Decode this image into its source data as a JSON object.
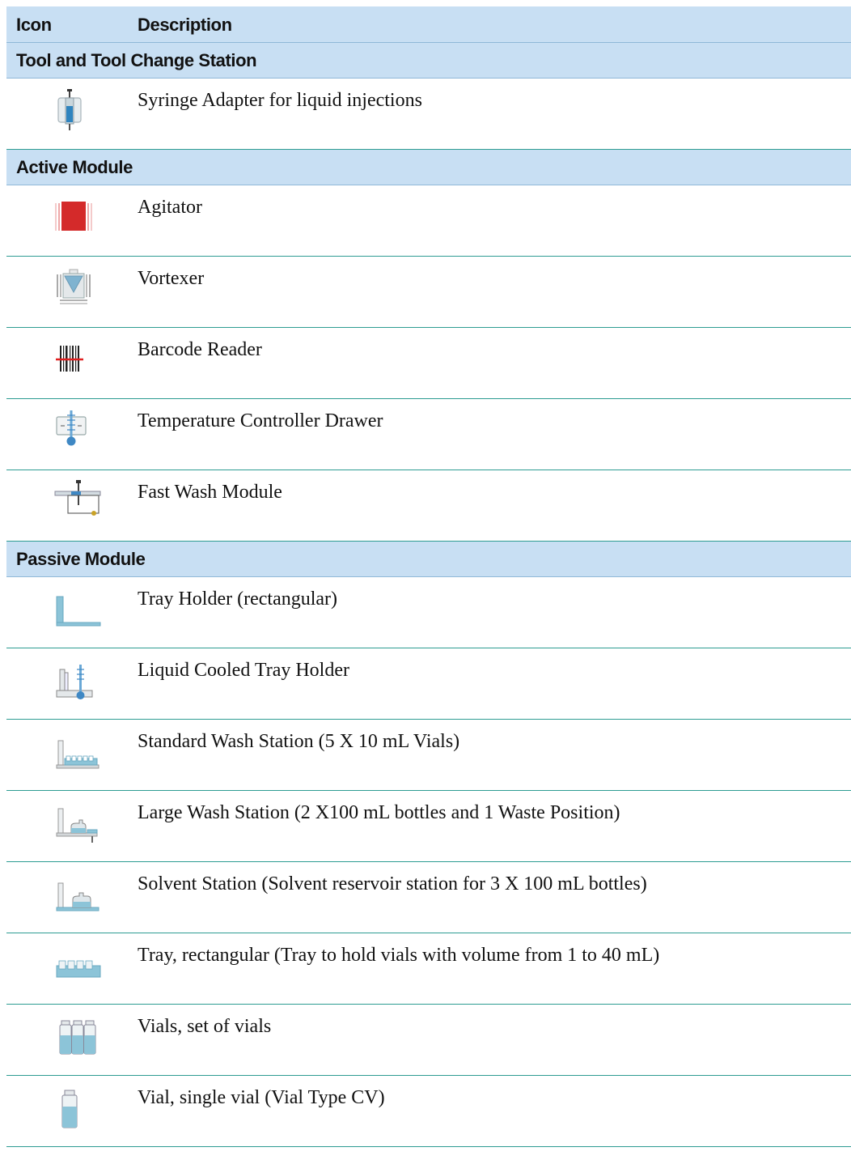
{
  "header": {
    "icon_label": "Icon",
    "description_label": "Description"
  },
  "sections": [
    {
      "title": "Tool and Tool Change Station",
      "items": [
        {
          "icon": "syringe-adapter-icon",
          "text": "Syringe Adapter for liquid injections"
        }
      ]
    },
    {
      "title": "Active Module",
      "items": [
        {
          "icon": "agitator-icon",
          "text": "Agitator"
        },
        {
          "icon": "vortexer-icon",
          "text": "Vortexer"
        },
        {
          "icon": "barcode-reader-icon",
          "text": "Barcode Reader"
        },
        {
          "icon": "temperature-controller-drawer-icon",
          "text": "Temperature Controller Drawer"
        },
        {
          "icon": "fast-wash-module-icon",
          "text": "Fast Wash Module"
        }
      ]
    },
    {
      "title": "Passive Module",
      "items": [
        {
          "icon": "tray-holder-icon",
          "text": "Tray Holder (rectangular)"
        },
        {
          "icon": "liquid-cooled-tray-holder-icon",
          "text": "Liquid Cooled Tray Holder"
        },
        {
          "icon": "standard-wash-station-icon",
          "text": "Standard Wash Station (5 X 10 mL Vials)"
        },
        {
          "icon": "large-wash-station-icon",
          "text": "Large Wash Station (2 X100 mL bottles and 1 Waste Position)"
        },
        {
          "icon": "solvent-station-icon",
          "text": "Solvent Station (Solvent reservoir station for 3 X 100 mL bottles)"
        },
        {
          "icon": "tray-rectangular-icon",
          "text": "Tray, rectangular (Tray to hold vials with volume from 1 to 40 mL)"
        },
        {
          "icon": "vials-set-icon",
          "text": "Vials, set of vials"
        },
        {
          "icon": "single-vial-icon",
          "text": "Vial, single vial (Vial Type CV)"
        }
      ]
    }
  ]
}
